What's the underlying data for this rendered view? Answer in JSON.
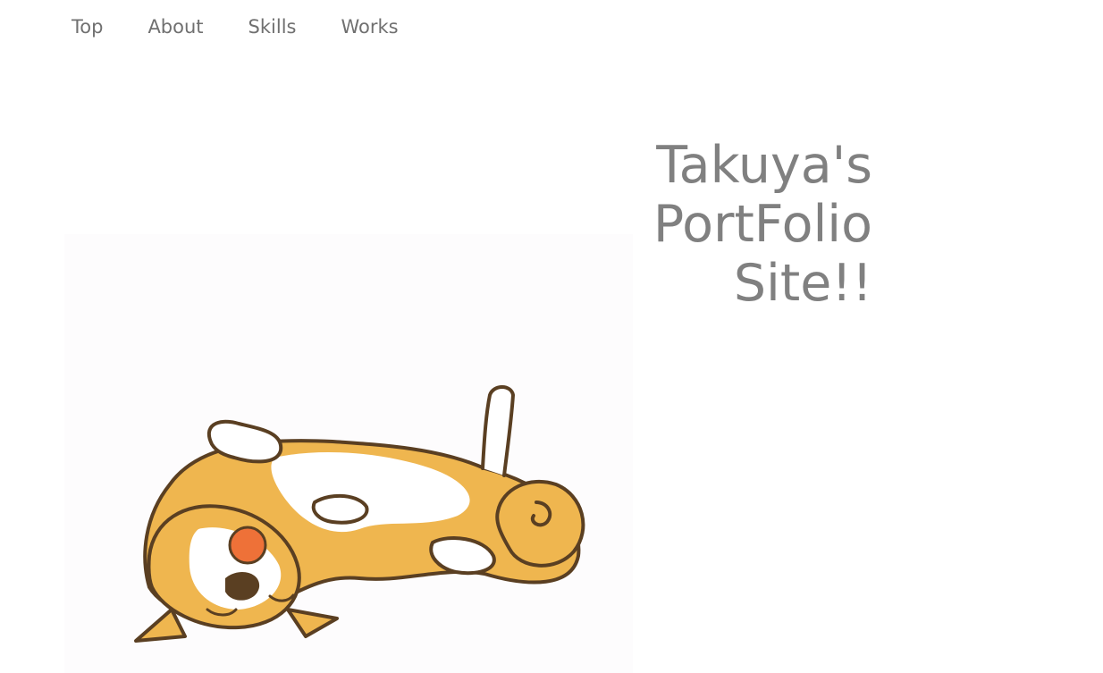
{
  "nav": {
    "items": [
      {
        "label": "Top"
      },
      {
        "label": "About"
      },
      {
        "label": "Skills"
      },
      {
        "label": "Works"
      }
    ]
  },
  "hero": {
    "title_lines": [
      "Takuya's",
      "PortFolio",
      "Site!!"
    ]
  },
  "colors": {
    "nav_text": "#707070",
    "title_text": "#808080",
    "dog_fur": "#efb64f",
    "dog_outline": "#5a3f22",
    "dog_tongue": "#ee7138"
  }
}
